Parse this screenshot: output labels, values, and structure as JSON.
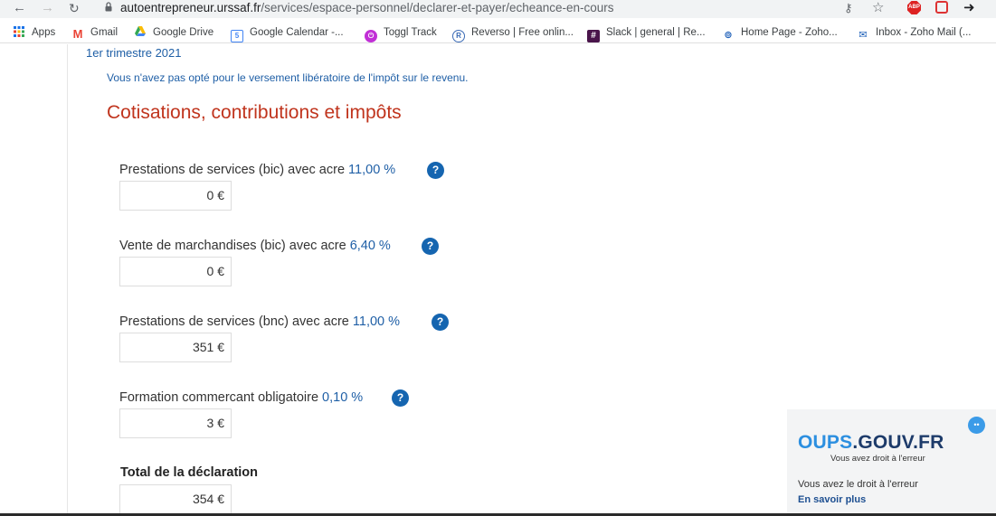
{
  "browser": {
    "url_host": "autoentrepreneur.urssaf.fr",
    "url_path": "/services/espace-personnel/declarer-et-payer/echeance-en-cours",
    "abp_label": "ABP"
  },
  "bookmarks": [
    {
      "label": "Apps",
      "icon": "apps-grid-icon"
    },
    {
      "label": "Gmail",
      "icon": "gmail-icon"
    },
    {
      "label": "Google Drive",
      "icon": "google-drive-icon"
    },
    {
      "label": "Google Calendar -...",
      "icon": "google-calendar-icon"
    },
    {
      "label": "Toggl Track",
      "icon": "toggl-icon"
    },
    {
      "label": "Reverso | Free onlin...",
      "icon": "reverso-icon"
    },
    {
      "label": "Slack | general | Re...",
      "icon": "slack-icon"
    },
    {
      "label": "Home Page - Zoho...",
      "icon": "zoho-icon"
    },
    {
      "label": "Inbox - Zoho Mail (...",
      "icon": "zoho-mail-icon"
    }
  ],
  "page": {
    "period": "1er trimestre 2021",
    "notice": "Vous n'avez pas opté pour le versement libératoire de l'impôt sur le revenu.",
    "section_title": "Cotisations, contributions et impôts",
    "help_symbol": "?",
    "fields": [
      {
        "label": "Prestations de services (bic) avec acre",
        "rate": "11,00 %",
        "amount": "0 €"
      },
      {
        "label": "Vente de marchandises (bic) avec acre",
        "rate": "6,40 %",
        "amount": "0 €"
      },
      {
        "label": "Prestations de services (bnc) avec acre",
        "rate": "11,00 %",
        "amount": "351 €"
      },
      {
        "label": "Formation commercant obligatoire",
        "rate": "0,10 %",
        "amount": "3 €"
      }
    ],
    "total": {
      "label": "Total de la déclaration",
      "amount": "354 €"
    }
  },
  "oups": {
    "logo_main": "OUPS",
    "logo_suffix": ".GOUV.FR",
    "tagline": "Vous avez droit à l'erreur",
    "text": "Vous avez le droit à l'erreur",
    "link": "En savoir plus"
  },
  "colors": {
    "link_blue": "#1f5fa6",
    "title_red": "#c0341d",
    "help_blue": "#1565b0"
  }
}
